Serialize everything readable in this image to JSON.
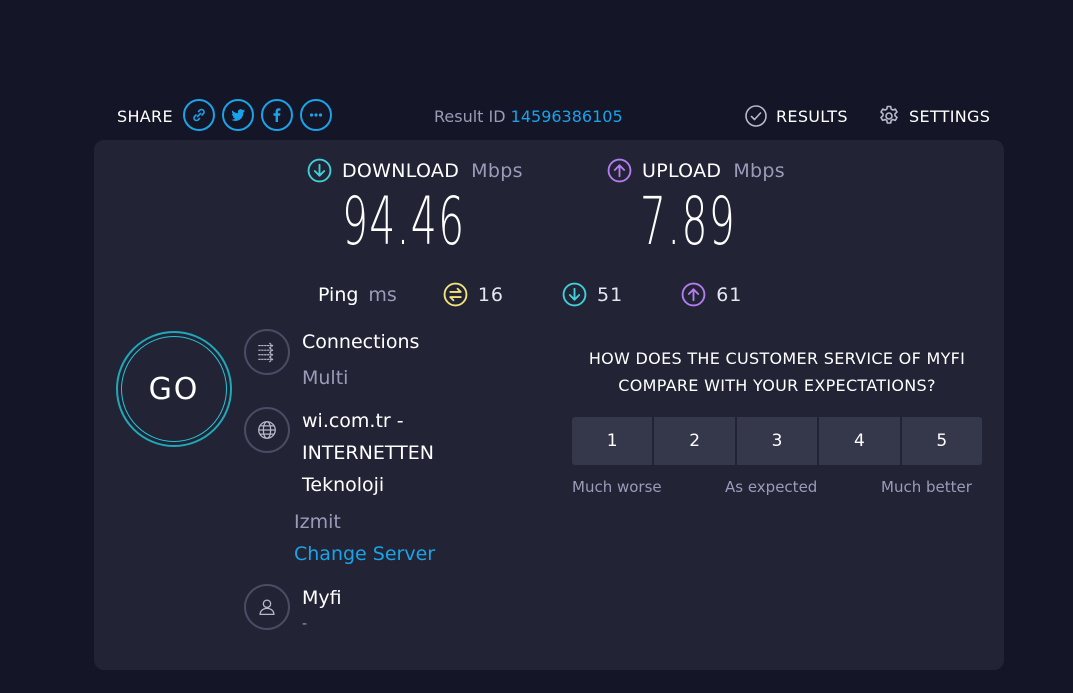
{
  "share": {
    "label": "SHARE",
    "buttons": [
      "link-icon",
      "twitter-icon",
      "facebook-icon",
      "more-icon"
    ]
  },
  "result": {
    "label": "Result ID",
    "id": "14596386105"
  },
  "nav": {
    "results_label": "RESULTS",
    "settings_label": "SETTINGS"
  },
  "download": {
    "label": "DOWNLOAD",
    "unit": "Mbps",
    "value": "94.46",
    "color": "#3fd0d9"
  },
  "upload": {
    "label": "UPLOAD",
    "unit": "Mbps",
    "value": "7.89",
    "color": "#b57cf0"
  },
  "ping": {
    "label": "Ping",
    "unit": "ms",
    "idle": "16",
    "download": "51",
    "upload": "61",
    "idle_color": "#f2e37a"
  },
  "go": {
    "label": "GO"
  },
  "connections": {
    "title": "Connections",
    "value": "Multi"
  },
  "server": {
    "line1": "wi.com.tr -",
    "line2": "INTERNETTEN",
    "line3": "Teknoloji",
    "location": "Izmit",
    "change_label": "Change Server"
  },
  "provider": {
    "name": "Myfi",
    "ip": "-"
  },
  "survey": {
    "question_line1": "HOW DOES THE CUSTOMER SERVICE OF MYFI",
    "question_line2": "COMPARE WITH YOUR EXPECTATIONS?",
    "options": [
      "1",
      "2",
      "3",
      "4",
      "5"
    ],
    "low_label": "Much worse",
    "mid_label": "As expected",
    "high_label": "Much better"
  }
}
